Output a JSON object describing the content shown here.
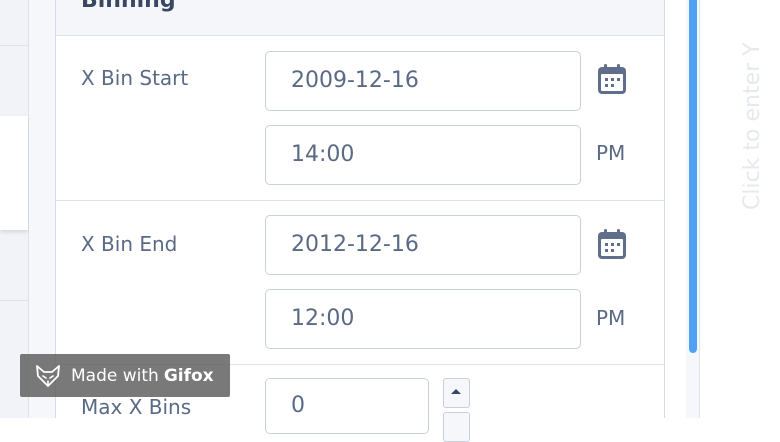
{
  "panel": {
    "title": "Binning"
  },
  "fields": {
    "x_bin_start": {
      "label": "X Bin Start",
      "date": "2009-12-16",
      "time": "14:00",
      "ampm": "PM"
    },
    "x_bin_end": {
      "label": "X Bin End",
      "date": "2012-12-16",
      "time": "12:00",
      "ampm": "PM"
    },
    "max_x_bins": {
      "label": "Max X Bins",
      "value": "0"
    }
  },
  "placeholder": {
    "text": "Click to enter Y"
  },
  "watermark": {
    "prefix": "Made with",
    "brand": "Gifox"
  },
  "colors": {
    "accent": "#4ea1f3",
    "text": "#5a6a85",
    "title": "#394764",
    "border": "#c9d0dc"
  },
  "icons": {
    "calendar": "calendar-icon",
    "stepper_up": "chevron-up-icon",
    "gifox_logo": "fox-icon"
  }
}
